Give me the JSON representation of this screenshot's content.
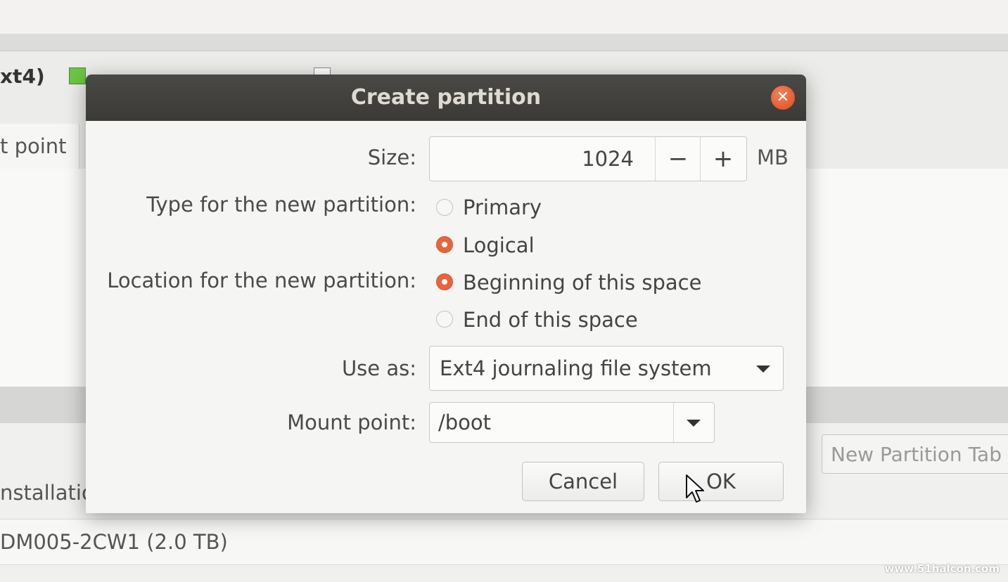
{
  "background": {
    "partition_bar_label": "xt4)",
    "column_header": "t point",
    "new_partition_table_button": "New Partition Tab",
    "installation_label": "nstallation",
    "device_row": "DM005-2CW1 (2.0 TB)",
    "watermark": "www.51halcon.com"
  },
  "dialog": {
    "title": "Create partition",
    "close_icon": "close-icon",
    "size": {
      "label": "Size:",
      "value": "1024",
      "minus": "−",
      "plus": "+",
      "unit": "MB"
    },
    "type": {
      "label": "Type for the new partition:",
      "options": [
        {
          "label": "Primary",
          "selected": false
        },
        {
          "label": "Logical",
          "selected": true
        }
      ]
    },
    "location": {
      "label": "Location for the new partition:",
      "options": [
        {
          "label": "Beginning of this space",
          "selected": true
        },
        {
          "label": "End of this space",
          "selected": false
        }
      ]
    },
    "use_as": {
      "label": "Use as:",
      "value": "Ext4 journaling file system"
    },
    "mount_point": {
      "label": "Mount point:",
      "value": "/boot"
    },
    "buttons": {
      "cancel": "Cancel",
      "ok": "OK"
    }
  },
  "colors": {
    "titlebar": "#3b3a37",
    "accent_radio": "#e9643b",
    "close_button": "#df4a1c"
  }
}
